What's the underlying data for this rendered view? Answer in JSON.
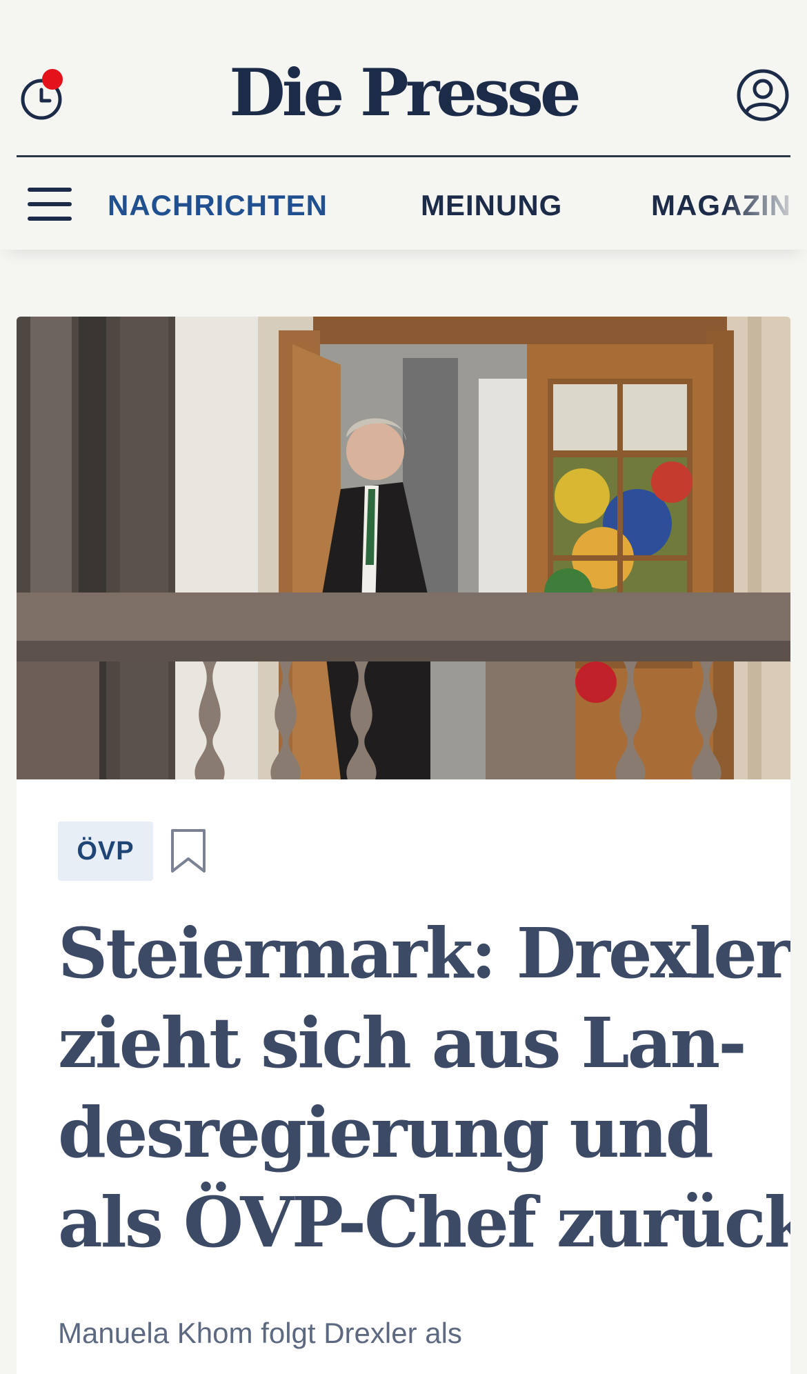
{
  "header": {
    "logo": "Die Presse",
    "history_icon": "clock-history-icon",
    "account_icon": "user-account-icon",
    "menu_icon": "hamburger-menu-icon",
    "notification_dot_color": "#e3121b"
  },
  "nav": {
    "items": [
      {
        "label": "NACHRICHTEN",
        "active": true
      },
      {
        "label": "MEINUNG",
        "active": false
      },
      {
        "label": "MAGAZIN",
        "active": false
      }
    ]
  },
  "article": {
    "tag": "ÖVP",
    "bookmark_icon": "bookmark-icon",
    "image": "photo-man-on-balcony-with-balustrade",
    "headline_lines": [
      "Steiermark: Drexler",
      "zieht sich aus Lan-",
      "desregierung und",
      "als ÖVP-Chef zurück"
    ],
    "lead": "Manuela Khom folgt Drexler als"
  },
  "colors": {
    "brand_navy": "#1c2b47",
    "active_nav": "#20508f",
    "headline": "#3d4a66",
    "tag_bg": "#e8eef6",
    "background": "#f5f5f2"
  }
}
